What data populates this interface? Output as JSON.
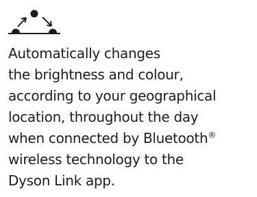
{
  "feature": {
    "icon": "sun-arc-icon",
    "description_lines": [
      "Automatically changes",
      "the brightness and colour,",
      "according to your geographical",
      "location, throughout the day",
      "when connected by Bluetooth",
      "wireless technology to the",
      "Dyson Link app."
    ],
    "trademark_symbol": "®"
  },
  "colors": {
    "text": "#1c1c1c",
    "background": "#ffffff"
  }
}
